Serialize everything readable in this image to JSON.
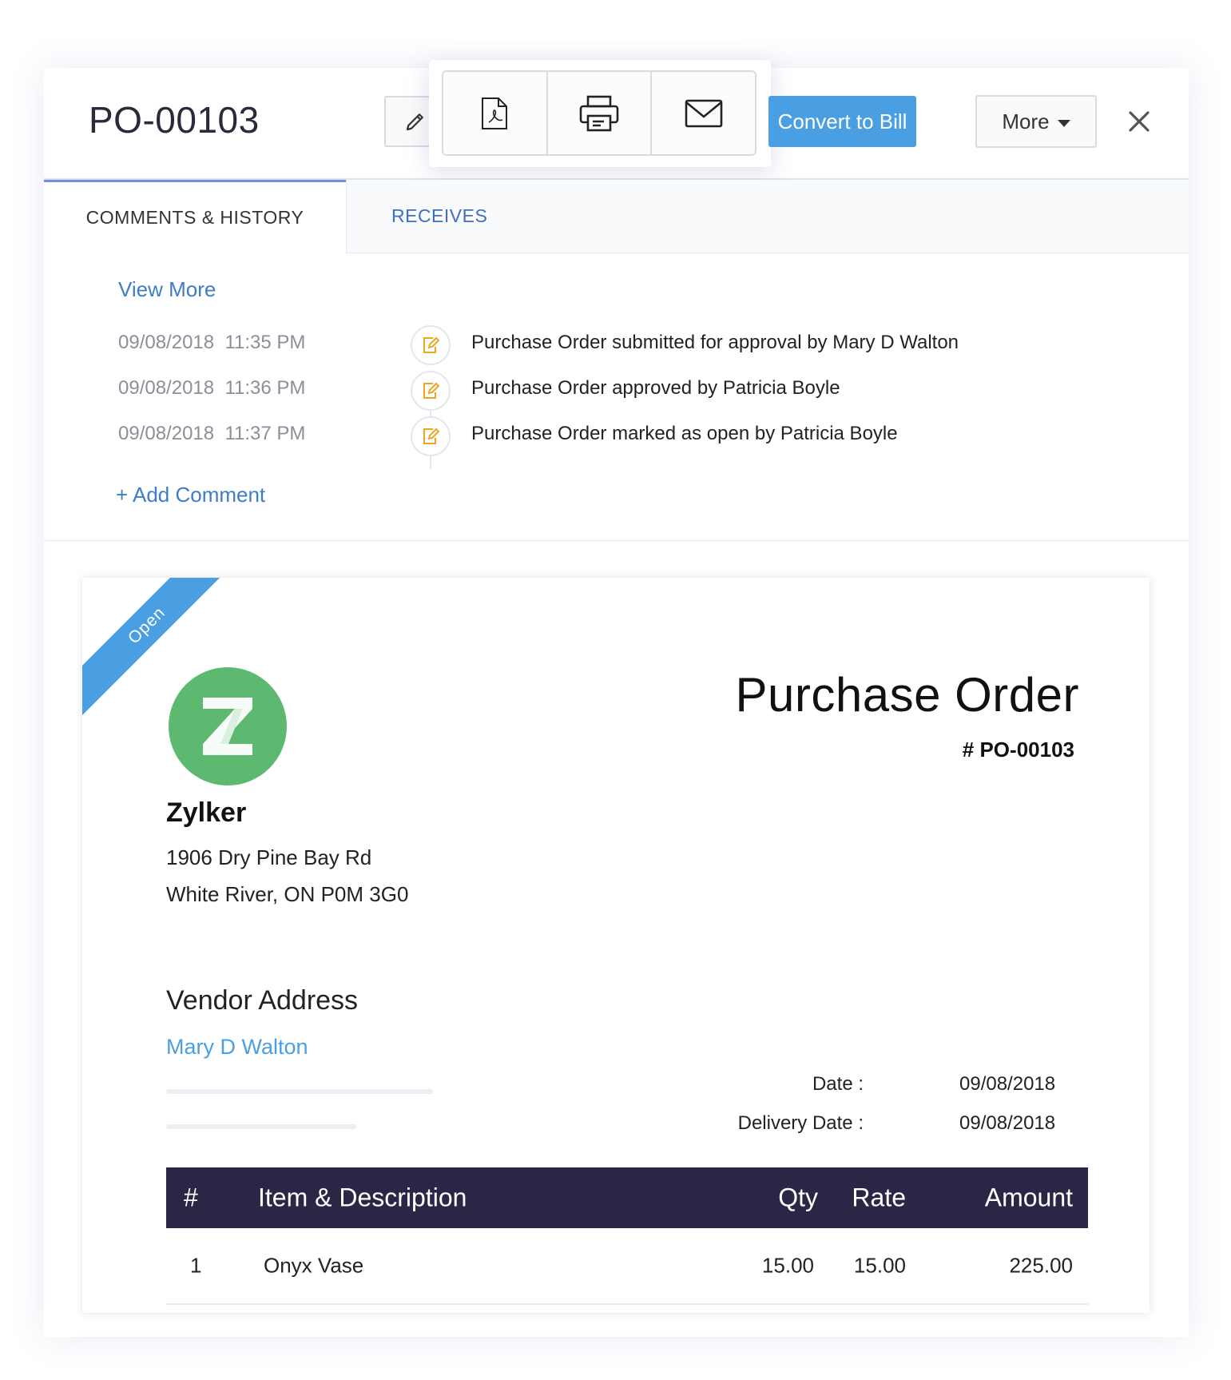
{
  "header": {
    "title": "PO-00103",
    "convert_label": "Convert to Bill",
    "more_label": "More"
  },
  "tabs": [
    {
      "label": "COMMENTS & HISTORY",
      "active": true
    },
    {
      "label": "RECEIVES",
      "active": false
    }
  ],
  "history": {
    "view_more": "View More",
    "entries": [
      {
        "time": "09/08/2018  11:35 PM",
        "text": "Purchase Order submitted for approval by Mary D Walton"
      },
      {
        "time": "09/08/2018  11:36 PM",
        "text": "Purchase Order approved by Patricia Boyle"
      },
      {
        "time": "09/08/2018  11:37 PM",
        "text": "Purchase Order marked as open by Patricia Boyle"
      }
    ],
    "add_comment": "+  Add Comment"
  },
  "document": {
    "status": "Open",
    "logo_letter": "Z",
    "company_name": "Zylker",
    "address_line1": "1906 Dry Pine Bay Rd",
    "address_line2": "White River, ON P0M 3G0",
    "title": "Purchase Order",
    "number": "# PO-00103",
    "vendor_heading": "Vendor Address",
    "vendor_name": "Mary D Walton",
    "date_label": "Date :",
    "date_value": "09/08/2018",
    "delivery_label": "Delivery Date :",
    "delivery_value": "09/08/2018",
    "columns": [
      "#",
      "Item & Description",
      "Qty",
      "Rate",
      "Amount"
    ],
    "items": [
      {
        "index": "1",
        "description": "Onyx Vase",
        "qty": "15.00",
        "rate": "15.00",
        "amount": "225.00"
      }
    ]
  },
  "colors": {
    "accent": "#4a9fe3",
    "link": "#3f7cc8",
    "table_header": "#2b2546",
    "logo": "#5db870",
    "history_icon": "#f0a520"
  },
  "icons": [
    "edit-pencil-icon",
    "pdf-icon",
    "print-icon",
    "mail-icon",
    "caret-down-icon",
    "close-icon",
    "history-edit-icon"
  ]
}
